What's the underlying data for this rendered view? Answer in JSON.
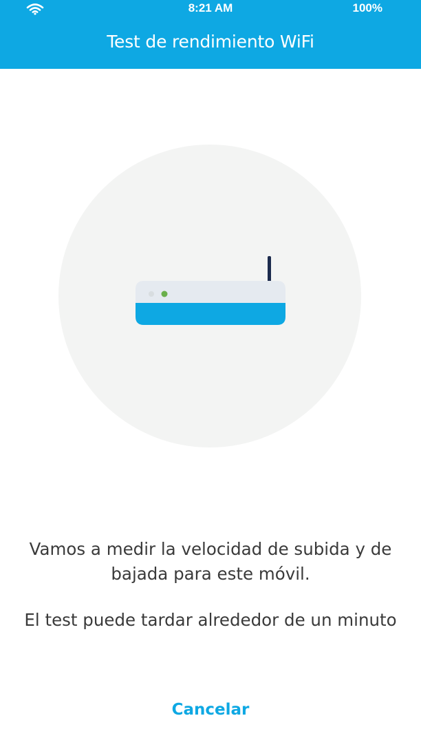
{
  "status_bar": {
    "time": "8:21 AM",
    "battery": "100%",
    "wifi_icon": "wifi-icon"
  },
  "header": {
    "title": "Test de rendimiento WiFi",
    "background_color": "#0ea8e3"
  },
  "illustration": {
    "icon": "router-icon",
    "circle_color": "#f3f4f3",
    "router_base_color": "#0ea8e3",
    "router_top_color": "#e5eaf0",
    "led_colors": [
      "#d8dde0",
      "#6ab04c"
    ],
    "antenna_color": "#1c2b4d"
  },
  "messages": {
    "line1": "Vamos a medir la velocidad de subida y de bajada para este móvil.",
    "line2": "El test puede tardar alrededor de un minuto"
  },
  "actions": {
    "cancel_label": "Cancelar",
    "accent_color": "#0ea8e3"
  }
}
